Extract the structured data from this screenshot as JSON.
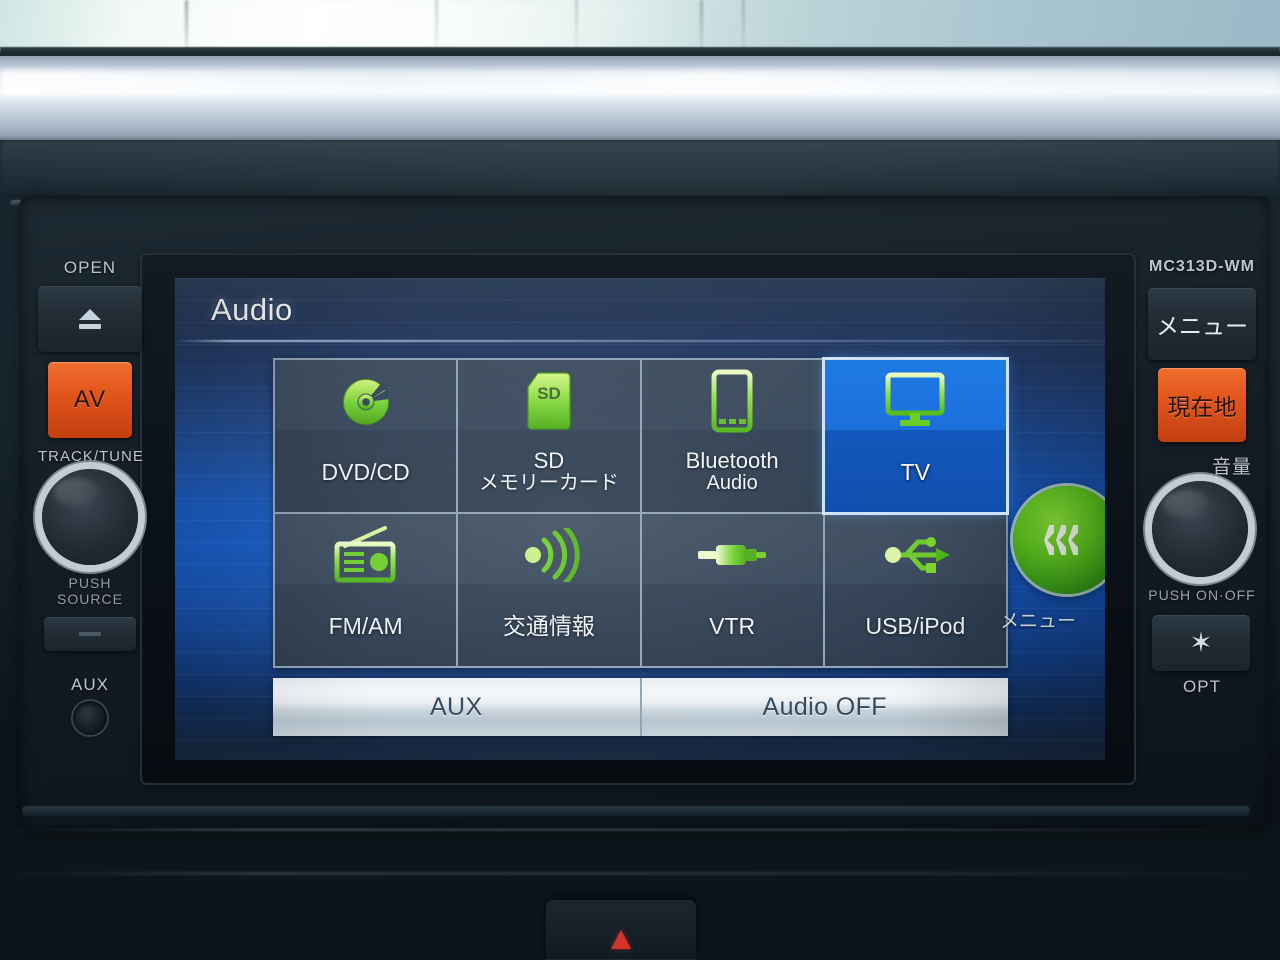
{
  "device": {
    "model_label": "MC313D-WM"
  },
  "screen": {
    "title": "Audio",
    "tiles": [
      {
        "label": "DVD/CD",
        "label2": "",
        "icon": "disc-icon",
        "selected": false
      },
      {
        "label": "SD",
        "label2": "メモリーカード",
        "icon": "sd-card-icon",
        "selected": false
      },
      {
        "label": "Bluetooth",
        "label2": "Audio",
        "icon": "smartphone-icon",
        "selected": false
      },
      {
        "label": "TV",
        "label2": "",
        "icon": "monitor-icon",
        "selected": true
      },
      {
        "label": "FM/AM",
        "label2": "",
        "icon": "radio-icon",
        "selected": false
      },
      {
        "label": "交通情報",
        "label2": "",
        "icon": "broadcast-wave-icon",
        "selected": false
      },
      {
        "label": "VTR",
        "label2": "",
        "icon": "av-plug-icon",
        "selected": false
      },
      {
        "label": "USB/iPod",
        "label2": "",
        "icon": "usb-icon",
        "selected": false
      }
    ],
    "bottom_buttons": [
      {
        "label": "AUX"
      },
      {
        "label": "Audio OFF"
      }
    ],
    "menu_shortcut": {
      "label": "メニュー",
      "icon": "double-chevron-left-icon"
    },
    "colors": {
      "accent_green": "#5cc41f",
      "selected_blue": "#1b6fdc",
      "screen_blue": "#1556b9",
      "tile_slate": "#36475a"
    }
  },
  "left_panel": {
    "open_label": "OPEN",
    "eject_icon": "eject-icon",
    "av_button": "AV",
    "track_tune_label": "TRACK/TUNE",
    "push_source_label": "PUSH SOURCE",
    "aux_label": "AUX"
  },
  "right_panel": {
    "menu_button": "メニュー",
    "current_location_button": "現在地",
    "volume_label": "音量",
    "push_onoff_label": "PUSH ON·OFF",
    "opt_icon": "star-icon",
    "opt_label": "OPT"
  }
}
